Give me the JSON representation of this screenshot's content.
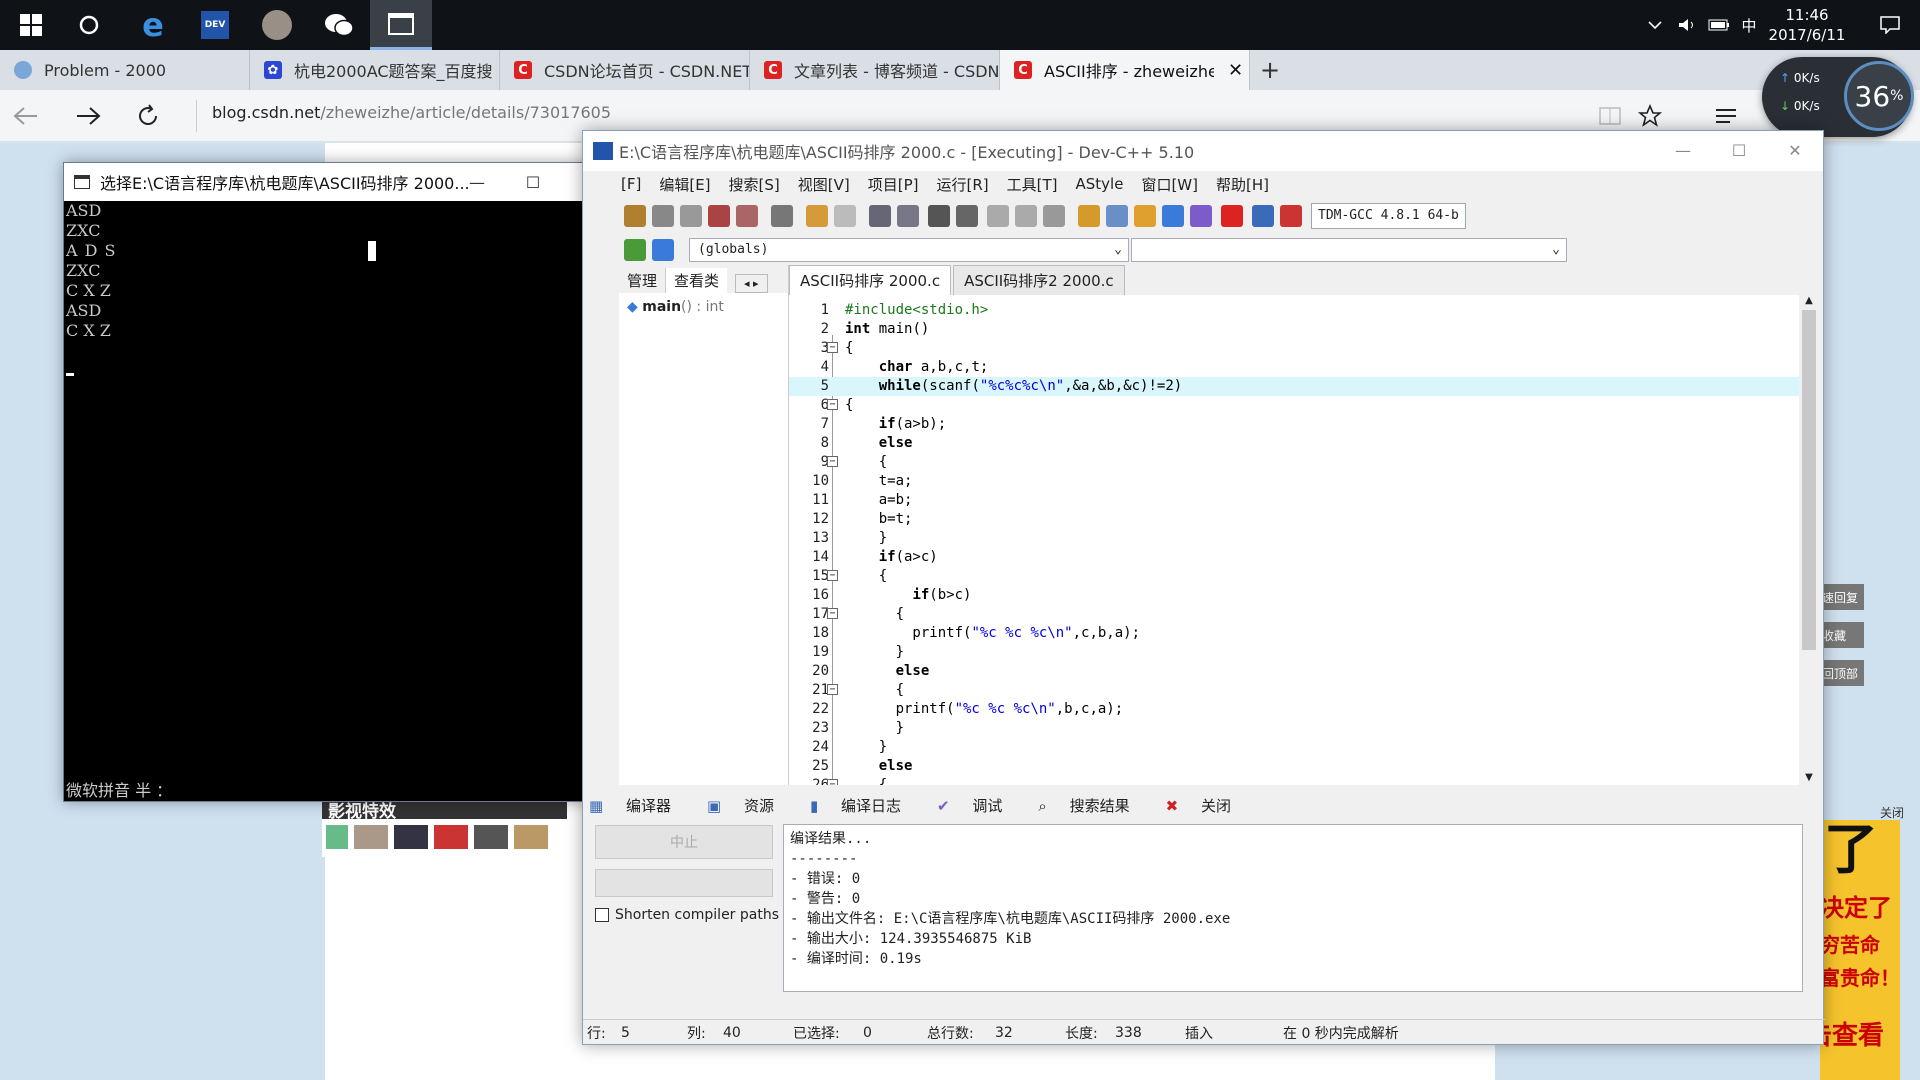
{
  "taskbar": {
    "time": "11:46",
    "date": "2017/6/11",
    "ime": "中"
  },
  "tabs": [
    {
      "label": "Problem - 2000"
    },
    {
      "label": "杭电2000AC题答案_百度搜"
    },
    {
      "label": "CSDN论坛首页 - CSDN.NET"
    },
    {
      "label": "文章列表 - 博客频道 - CSDN"
    },
    {
      "label": "ASCII排序 - zheweizhe的"
    }
  ],
  "url": {
    "host": "blog.csdn.net",
    "path": "/zheweizhe/article/details/73017605"
  },
  "netmon": {
    "up": "0K/s",
    "down": "0K/s",
    "percent": "36",
    "unit": "%"
  },
  "console": {
    "title": "选择E:\\C语言程序库\\杭电题库\\ASCII码排序 2000...",
    "lines": [
      "ASD",
      "ZXC",
      "A D S",
      "ZXC",
      "C X Z",
      "ASD",
      "C X Z"
    ],
    "ime": "微软拼音 半 ："
  },
  "page": {
    "video_label": "影视特效",
    "close_label": "关闭",
    "side": [
      "速回复",
      "收藏",
      "回顶部"
    ],
    "ad_lines": [
      "了",
      "决定了",
      "穷苦命",
      "富贵命！",
      "点击查看"
    ]
  },
  "devcpp": {
    "title": "E:\\C语言程序库\\杭电题库\\ASCII码排序 2000.c - [Executing] - Dev-C++ 5.10",
    "menu": [
      "[F]",
      "编辑[E]",
      "搜索[S]",
      "视图[V]",
      "项目[P]",
      "运行[R]",
      "工具[T]",
      "AStyle",
      "窗口[W]",
      "帮助[H]"
    ],
    "compiler": "TDM-GCC 4.8.1 64-b",
    "scope": "(globals)",
    "left_tabs": [
      "管理",
      "查看类"
    ],
    "class_item": "main",
    "class_item_sig": "() : int",
    "editor_tabs": [
      "ASCII码排序 2000.c",
      "ASCII码排序2 2000.c"
    ],
    "code": [
      "#include<stdio.h>",
      "int main()",
      "{",
      "    char a,b,c,t;",
      "    while(scanf(\"%c%c%c\\n\",&a,&b,&c)!=2)",
      "{",
      "    if(a>b);",
      "    else",
      "    {",
      "    t=a;",
      "    a=b;",
      "    b=t;",
      "    }",
      "    if(a>c)",
      "    {",
      "        if(b>c)",
      "      {",
      "        printf(\"%c %c %c\\n\",c,b,a);",
      "      }",
      "      else",
      "      {",
      "      printf(\"%c %c %c\\n\",b,c,a);",
      "      }",
      "    }",
      "    else",
      "    {"
    ],
    "bottom_tabs": [
      "编译器",
      "资源",
      "编译日志",
      "调试",
      "搜索结果",
      "关闭"
    ],
    "abort_label": "中止",
    "shorten_label": "Shorten compiler paths",
    "log": [
      "编译结果...",
      "--------",
      "- 错误: 0",
      "- 警告: 0",
      "- 输出文件名: E:\\C语言程序库\\杭电题库\\ASCII码排序 2000.exe",
      "- 输出大小: 124.3935546875 KiB",
      "- 编译时间: 0.19s"
    ],
    "status": {
      "row_label": "行:",
      "row": "5",
      "col_label": "列:",
      "col": "40",
      "sel_label": "已选择:",
      "sel": "0",
      "total_label": "总行数:",
      "total": "32",
      "len_label": "长度:",
      "len": "338",
      "mode": "插入",
      "parse": "在 0 秒内完成解析"
    }
  }
}
